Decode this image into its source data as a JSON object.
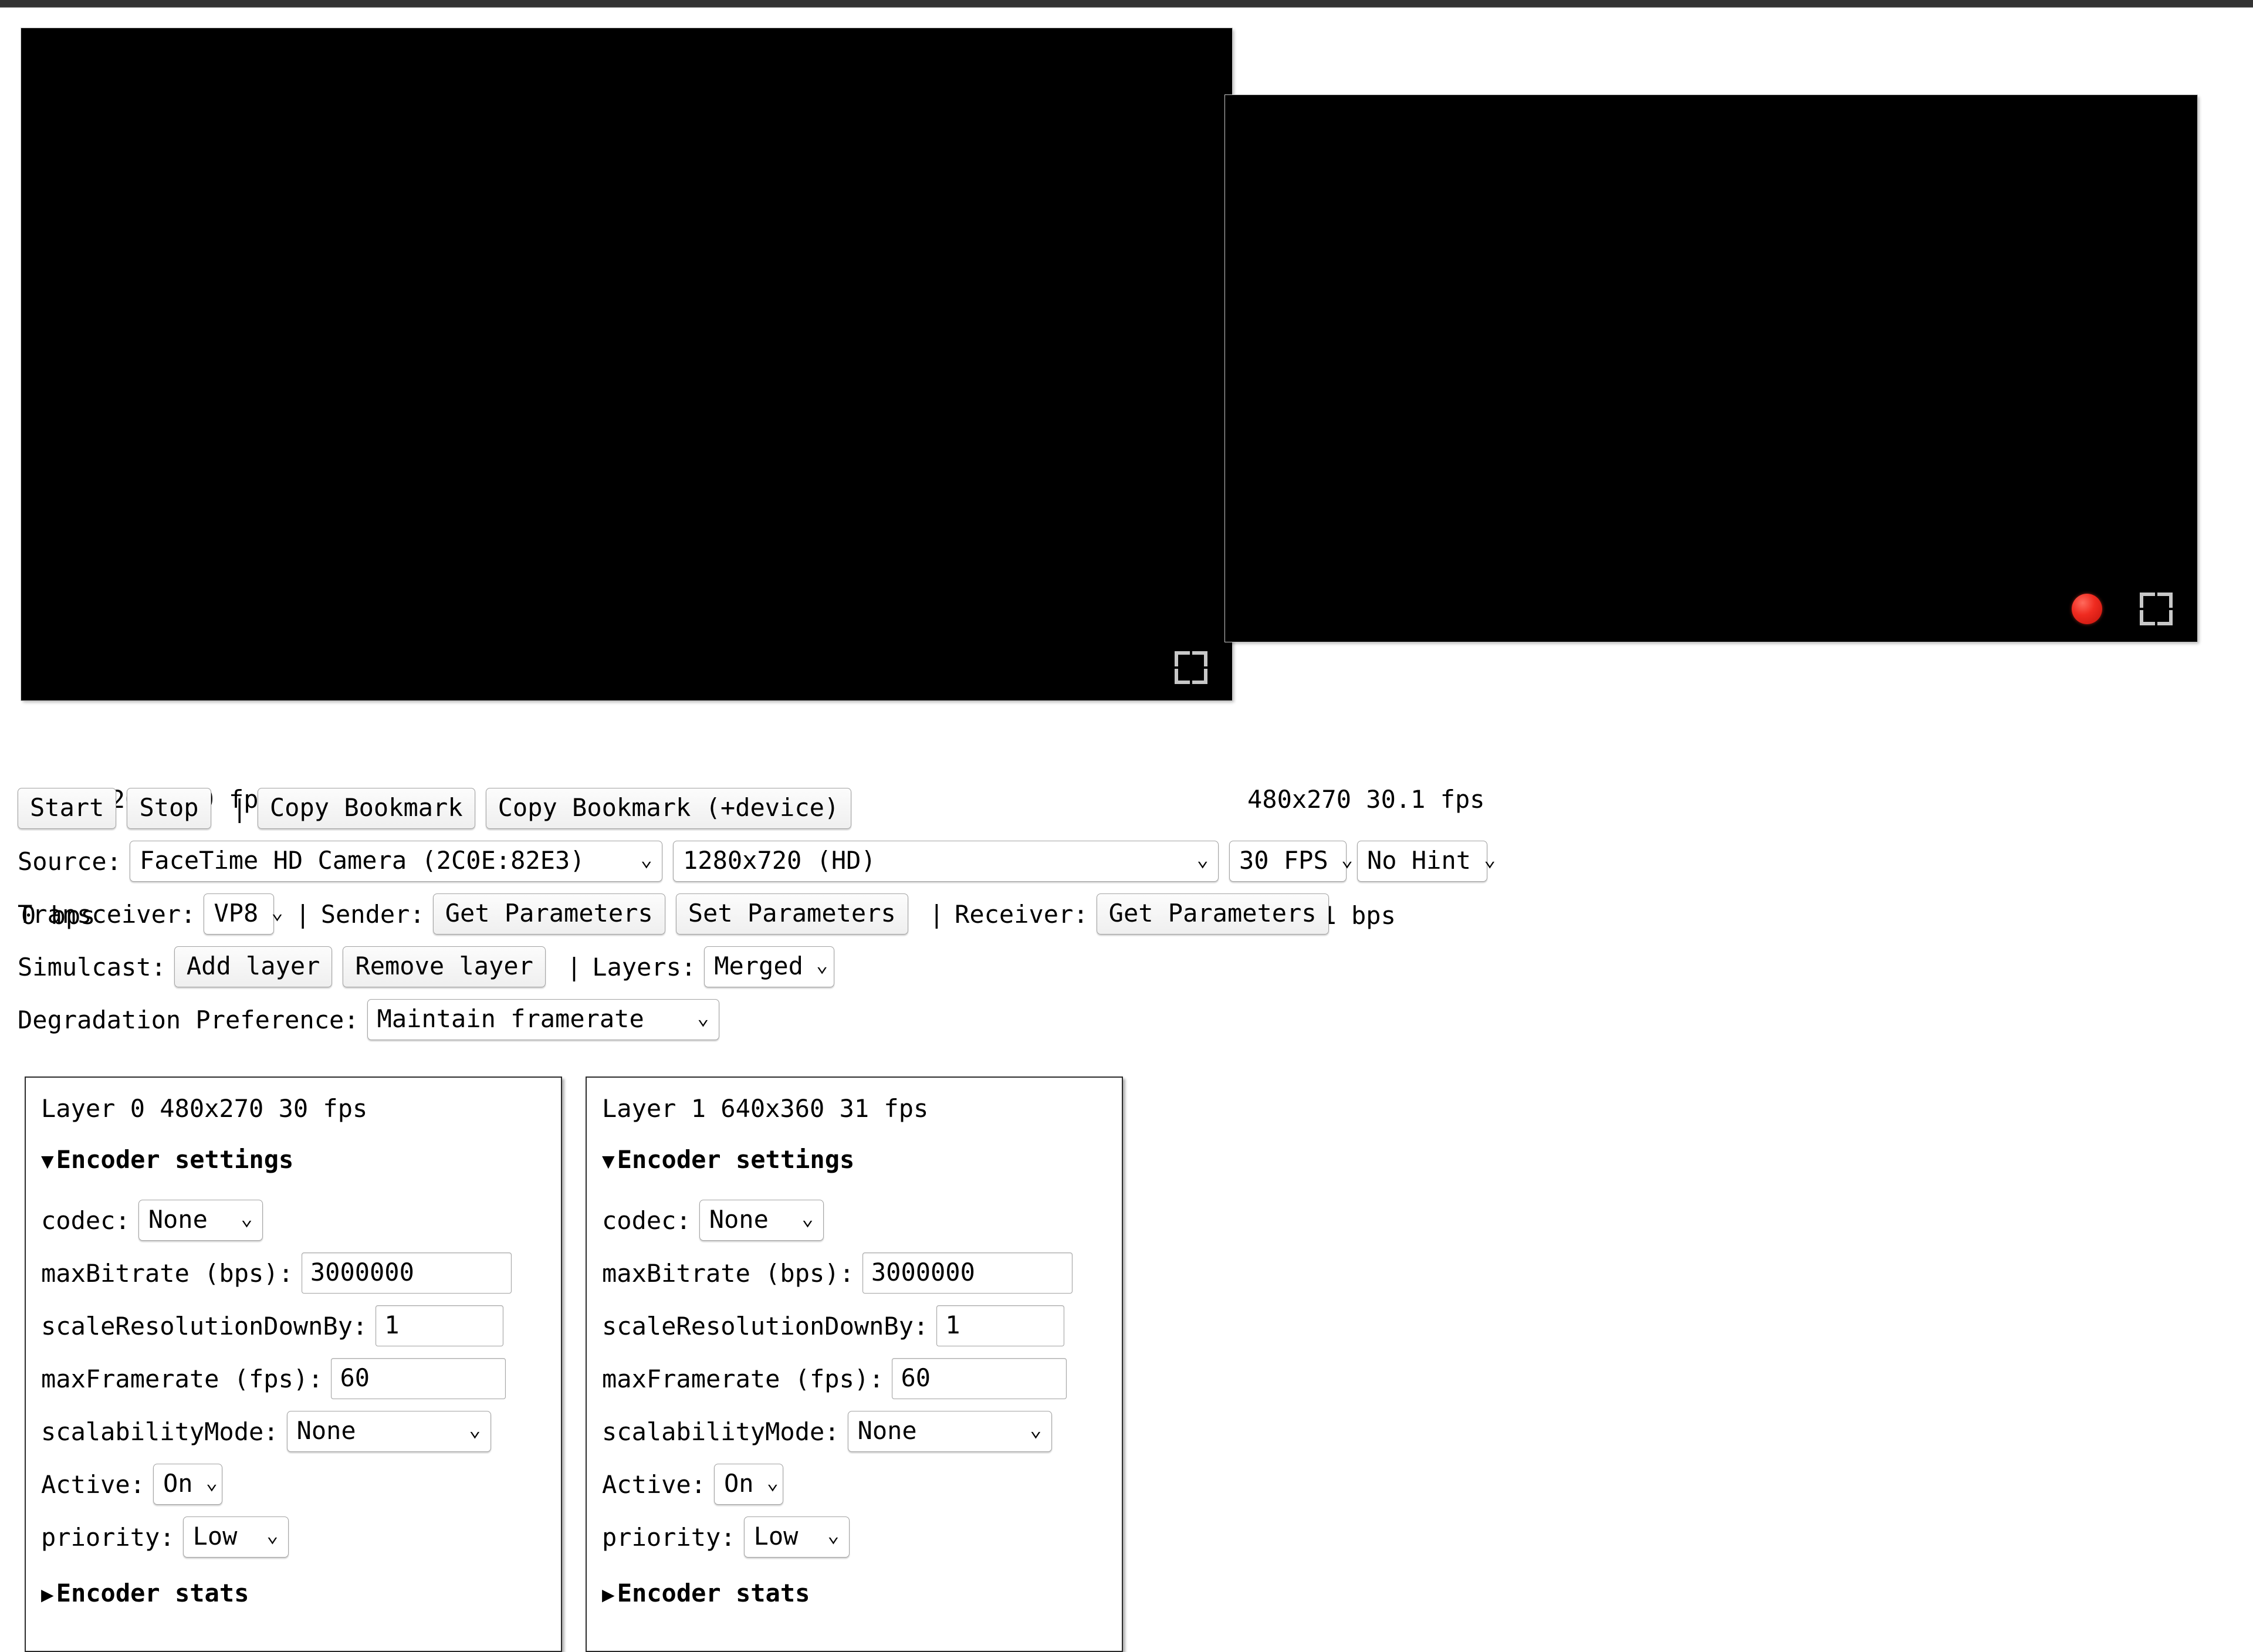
{
  "window": {
    "chrome_color": "#333333"
  },
  "video_local": {
    "name": "local-video",
    "fullscreen_icon": "fullscreen-icon",
    "stats": {
      "resolution_fps": "1280x720 30.0 fps",
      "bitrate": "0 bps"
    }
  },
  "video_remote": {
    "name": "remote-video",
    "record_icon": "record-indicator-icon",
    "record_color": "#ef2b20",
    "fullscreen_icon": "fullscreen-icon",
    "stats": {
      "resolution_fps": "480x270 30.1 fps",
      "bitrate": "429421 bps"
    }
  },
  "controls": {
    "start_label": "Start",
    "stop_label": "Stop",
    "separator": "|",
    "copy_bookmark_label": "Copy Bookmark",
    "copy_bookmark_device_label": "Copy Bookmark (+device)",
    "source_label": "Source:",
    "source_value": "FaceTime HD Camera (2C0E:82E3)",
    "resolution_value": "1280x720 (HD)",
    "fps_value": "30 FPS",
    "hint_value": "No Hint",
    "transceiver_label": "Transceiver:",
    "transceiver_value": "VP8",
    "sender_label": "Sender:",
    "sender_get_params_label": "Get Parameters",
    "sender_set_params_label": "Set Parameters",
    "receiver_label": "Receiver:",
    "receiver_get_params_label": "Get Parameters",
    "simulcast_label": "Simulcast:",
    "add_layer_label": "Add layer",
    "remove_layer_label": "Remove layer",
    "layers_label": "Layers:",
    "layers_value": "Merged",
    "degradation_label": "Degradation Preference:",
    "degradation_value": "Maintain framerate",
    "caret": "⌄"
  },
  "layers": [
    {
      "title": "Layer 0 480x270 30 fps",
      "encoder_settings_label": "Encoder settings",
      "expanded_marker": "▼",
      "collapsed_marker": "▶",
      "codec_label": "codec:",
      "codec_value": "None",
      "max_bitrate_label": "maxBitrate (bps):",
      "max_bitrate_value": "3000000",
      "scale_label": "scaleResolutionDownBy:",
      "scale_value": "1",
      "max_framerate_label": "maxFramerate (fps):",
      "max_framerate_value": "60",
      "scalability_label": "scalabilityMode:",
      "scalability_value": "None",
      "active_label": "Active:",
      "active_value": "On",
      "priority_label": "priority:",
      "priority_value": "Low",
      "encoder_stats_label": "Encoder stats"
    },
    {
      "title": "Layer 1 640x360 31 fps",
      "encoder_settings_label": "Encoder settings",
      "expanded_marker": "▼",
      "collapsed_marker": "▶",
      "codec_label": "codec:",
      "codec_value": "None",
      "max_bitrate_label": "maxBitrate (bps):",
      "max_bitrate_value": "3000000",
      "scale_label": "scaleResolutionDownBy:",
      "scale_value": "1",
      "max_framerate_label": "maxFramerate (fps):",
      "max_framerate_value": "60",
      "scalability_label": "scalabilityMode:",
      "scalability_value": "None",
      "active_label": "Active:",
      "active_value": "On",
      "priority_label": "priority:",
      "priority_value": "Low",
      "encoder_stats_label": "Encoder stats"
    }
  ]
}
